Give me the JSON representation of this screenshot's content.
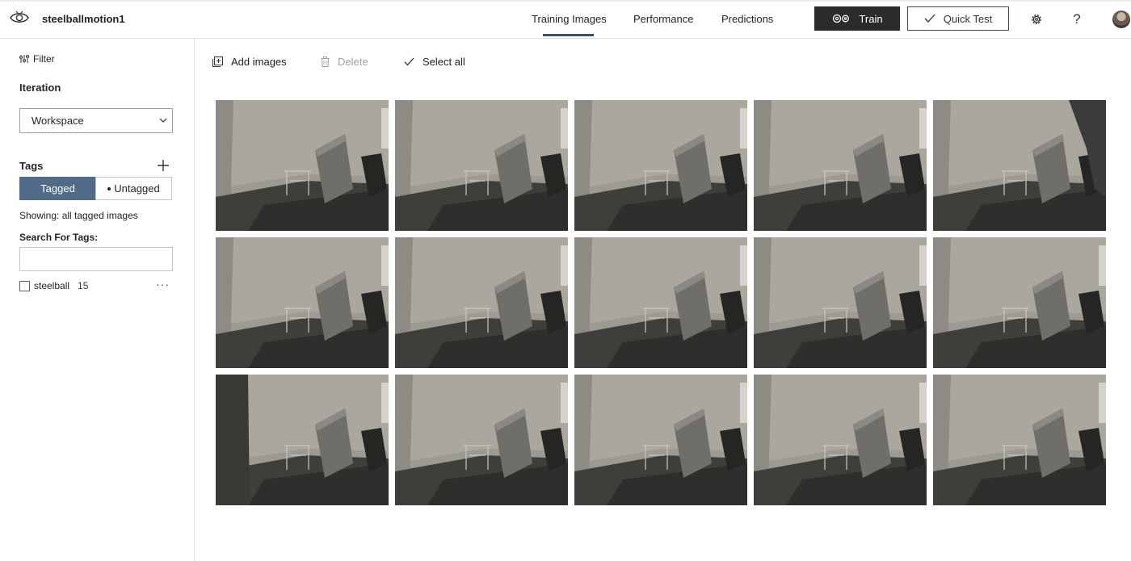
{
  "header": {
    "project_name": "steelballmotion1",
    "tabs": [
      {
        "label": "Training Images",
        "active": true
      },
      {
        "label": "Performance",
        "active": false
      },
      {
        "label": "Predictions",
        "active": false
      }
    ],
    "train_label": "Train",
    "quick_test_label": "Quick Test",
    "help_label": "?",
    "accent_color": "#3a5068"
  },
  "sidebar": {
    "filter_label": "Filter",
    "iteration_heading": "Iteration",
    "iteration_value": "Workspace",
    "tags_heading": "Tags",
    "tagged_label": "Tagged",
    "untagged_label": "Untagged",
    "showing_text": "Showing: all tagged images",
    "search_heading": "Search For Tags:",
    "search_value": "",
    "tags": [
      {
        "name": "steelball",
        "count": "15"
      }
    ]
  },
  "toolbar": {
    "add_images_label": "Add images",
    "delete_label": "Delete",
    "select_all_label": "Select all"
  },
  "images": {
    "count": 15,
    "rows": 3,
    "columns": 5,
    "tag": "steelball"
  }
}
